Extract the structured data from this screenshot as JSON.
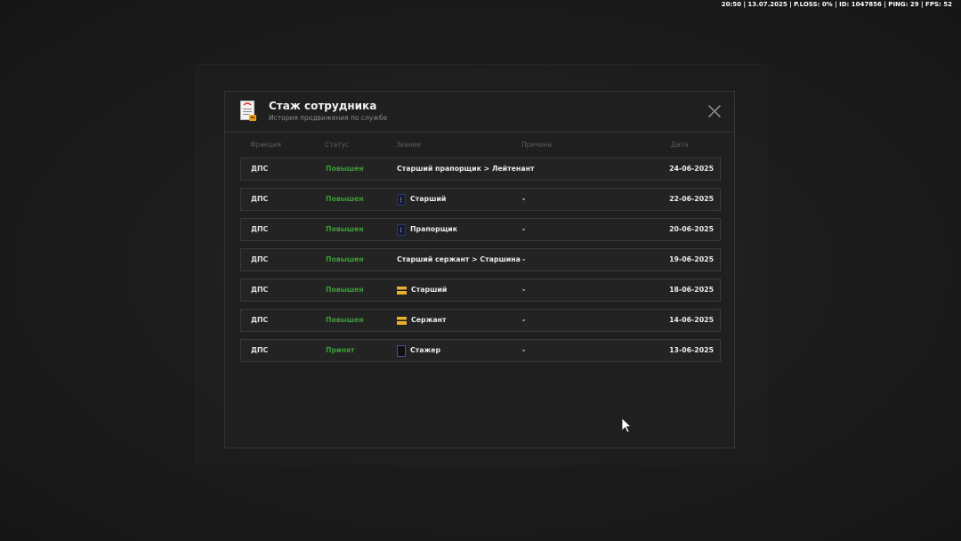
{
  "hud": {
    "text": "20:50 | 13.07.2025 | P.LOSS: 0% | ID: 1047856 | PING: 29 | FPS: 52"
  },
  "modal": {
    "title": "Стаж сотрудника",
    "subtitle": "История продвижения по службе",
    "icon": "document-icon",
    "close_icon": "close-icon"
  },
  "columns": {
    "faction": "Фракция",
    "status": "Статус",
    "rank": "Звание",
    "reason": "Причина",
    "date": "Дата"
  },
  "colors": {
    "status_green": "#3f9a3a",
    "badge_gold": "#e7b12a",
    "badge_navy": "#141a33"
  },
  "rows": [
    {
      "faction": "ДПС",
      "status": "Повышен",
      "rank": "Старший прапорщик > Лейтенант",
      "badge": "none",
      "reason": "-",
      "date": "24-06-2025"
    },
    {
      "faction": "ДПС",
      "status": "Повышен",
      "rank": "Старший",
      "badge": "navy",
      "reason": "-",
      "date": "22-06-2025"
    },
    {
      "faction": "ДПС",
      "status": "Повышен",
      "rank": "Прапорщик",
      "badge": "navy",
      "reason": "-",
      "date": "20-06-2025"
    },
    {
      "faction": "ДПС",
      "status": "Повышен",
      "rank": "Старший сержант > Старшина",
      "badge": "none",
      "reason": "-",
      "date": "19-06-2025"
    },
    {
      "faction": "ДПС",
      "status": "Повышен",
      "rank": "Старший",
      "badge": "gold",
      "reason": "-",
      "date": "18-06-2025"
    },
    {
      "faction": "ДПС",
      "status": "Повышен",
      "rank": "Сержант",
      "badge": "gold",
      "reason": "-",
      "date": "14-06-2025"
    },
    {
      "faction": "ДПС",
      "status": "Принят",
      "rank": "Стажер",
      "badge": "black",
      "reason": "-",
      "date": "13-06-2025"
    }
  ]
}
